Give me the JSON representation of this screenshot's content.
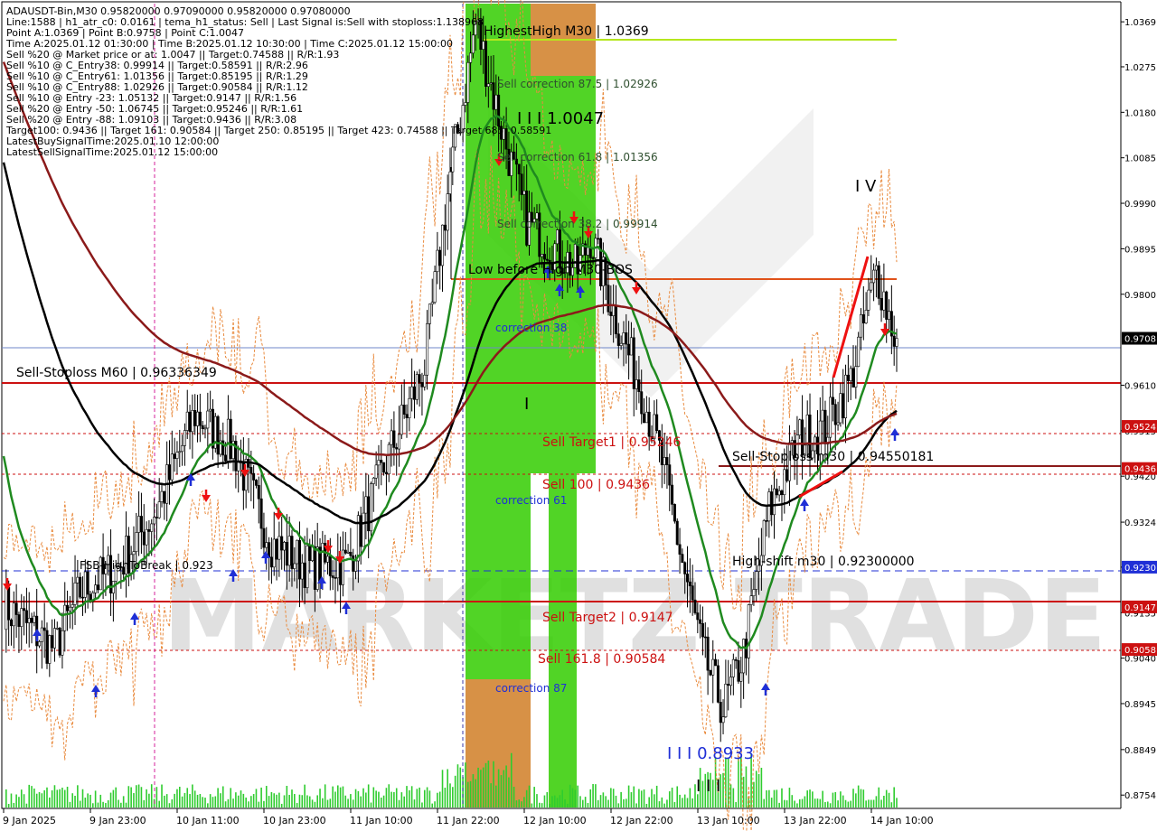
{
  "colors": {
    "background": "#ffffff",
    "candle": "#000000",
    "ema_green": "#1f8a1f",
    "ema_black": "#000000",
    "ema_darkred": "#8b1a1a",
    "red_line": "#cc1111",
    "orange_dashed": "#e0521a",
    "blue_dashed": "#1f2fd6",
    "band_orange": "#e98b3f",
    "zone_green": "#33cc00",
    "zone_orange": "#e58a4a",
    "volume": "#2fcc2f"
  },
  "info_lines": [
    "ADAUSDT-Bin,M30  0.95820000 0.97090000 0.95820000 0.97080000",
    "Line:1588 | h1_atr_c0: 0.0161 | tema_h1_status: Sell | Last Signal is:Sell with stoploss:1.138968",
    "Point A:1.0369 | Point B:0.9758 | Point C:1.0047",
    "Time A:2025.01.12 01:30:00 | Time B:2025.01.12 10:30:00 | Time C:2025.01.12 15:00:00",
    "Sell %20 @ Market price or at: 1.0047 || Target:0.74588 || R/R:1.93",
    "Sell %10 @ C_Entry38: 0.99914 || Target:0.58591 || R/R:2.96",
    "Sell %10 @ C_Entry61: 1.01356 || Target:0.85195 || R/R:1.29",
    "Sell %10 @ C_Entry88: 1.02926 || Target:0.90584 || R/R:1.12",
    "Sell %10 @ Entry -23: 1.05132 || Target:0.9147 || R/R:1.56",
    "Sell %20 @ Entry -50: 1.06745 || Target:0.95246 || R/R:1.61",
    "Sell %20 @ Entry -88: 1.09103 || Target:0.9436 || R/R:3.08",
    "Target100: 0.9436 || Target 161: 0.90584 || Target 250: 0.85195 || Target 423: 0.74588 || Target 685: 0.58591",
    "LatestBuySignalTime:2025.01.10 12:00:00",
    "LatestSellSignalTime:2025.01.12 15:00:00"
  ],
  "annotations": {
    "highest_high": "HighestHigh   M30 | 1.0369",
    "sell_corr_875": "Sell correction 87.5 | 1.02926",
    "sell_corr_618": "Sell correction 61.8 | 1.01356",
    "sell_corr_382": "Sell correction 38.2 | 0.99914",
    "wave_iii_c": "I I I 1.0047",
    "wave_iv": "I V",
    "wave_i": "I",
    "wave_iii_low": "I I I 0.8933",
    "wave_iii_bottom": "I I I",
    "low_before_high": "Low before High   M30-BOS",
    "correction_38": "correction 38",
    "correction_61": "correction 61",
    "correction_87": "correction 87",
    "sell_stoploss_m60": "Sell-Stoploss M60 | 0.96336349",
    "sell_stoploss_m30": "Sell-Stoploss m30 | 0.94550181",
    "sell_target1": "Sell Target1 | 0.95246",
    "sell_100": "Sell 100 | 0.9436",
    "high_shift": "High-shift m30 | 0.92300000",
    "fsb_break": "FSB-HighToBreak | 0.923",
    "sell_target2": "Sell Target2 | 0.9147",
    "sell_1618": "Sell 161.8 | 0.90584",
    "watermark": "MARKETZ TRADE"
  },
  "y_axis": {
    "ticks": [
      "1.0369",
      "1.0275",
      "1.0180",
      "1.0085",
      "0.9990",
      "0.9895",
      "0.9800",
      "0.9610",
      "0.9515",
      "0.9420",
      "0.9324",
      "0.9230",
      "0.9135",
      "0.9040",
      "0.8945",
      "0.8849",
      "0.8754"
    ],
    "badges": [
      "0.9708",
      "0.9524",
      "0.9436",
      "0.9230",
      "0.9147",
      "0.9058"
    ]
  },
  "x_axis": {
    "ticks": [
      "9 Jan 2025",
      "9 Jan 23:00",
      "10 Jan 11:00",
      "10 Jan 23:00",
      "11 Jan 10:00",
      "11 Jan 22:00",
      "12 Jan 10:00",
      "12 Jan 22:00",
      "13 Jan 10:00",
      "13 Jan 22:00",
      "14 Jan 10:00"
    ]
  },
  "chart_data": {
    "type": "candlestick",
    "symbol": "ADAUSDT-Bin",
    "timeframe": "M30",
    "ohlc_last": {
      "open": 0.9582,
      "high": 0.9709,
      "low": 0.9582,
      "close": 0.9708
    },
    "ylim": [
      0.8728,
      1.0407
    ],
    "levels": {
      "highest_high": 1.0369,
      "sell_correction_875": 1.02926,
      "sell_correction_618": 1.01356,
      "sell_correction_382": 0.99914,
      "point_c": 1.0047,
      "point_b": 0.9758,
      "low_before_high": 0.9854,
      "sell_stoploss_m60": 0.96336349,
      "sell_target1": 0.95246,
      "sell_stoploss_m30": 0.94550181,
      "sell_100": 0.9436,
      "high_shift": 0.923,
      "sell_target2": 0.9147,
      "sell_1618": 0.90584,
      "wave_iii_low": 0.8933,
      "current_price": 0.9708
    },
    "approx_close_path": [
      {
        "x": "9 Jan 2025",
        "y": 0.915
      },
      {
        "x": "9 Jan 23:00",
        "y": 0.923
      },
      {
        "x": "10 Jan 11:00",
        "y": 0.948
      },
      {
        "x": "10 Jan 23:00",
        "y": 0.923
      },
      {
        "x": "11 Jan 10:00",
        "y": 0.94
      },
      {
        "x": "11 Jan 22:00",
        "y": 1.025
      },
      {
        "x": "12 Jan 10:00",
        "y": 0.995
      },
      {
        "x": "12 Jan 22:00",
        "y": 0.96
      },
      {
        "x": "13 Jan 10:00",
        "y": 0.905
      },
      {
        "x": "13 Jan 22:00",
        "y": 0.949
      },
      {
        "x": "14 Jan 10:00",
        "y": 0.9708
      }
    ],
    "moving_averages": [
      {
        "name": "",
        "color": "#1f8a1f"
      },
      {
        "name": "",
        "color": "#000000"
      },
      {
        "name": "",
        "color": "#8b1a1a"
      }
    ]
  }
}
